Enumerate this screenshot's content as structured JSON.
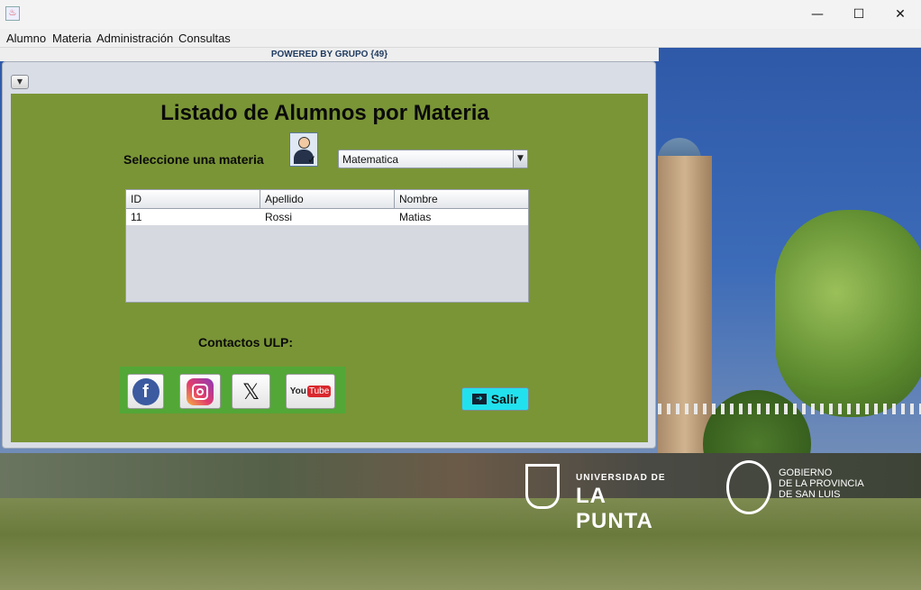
{
  "window": {
    "minimize_glyph": "—",
    "maximize_glyph": "☐",
    "close_glyph": "✕"
  },
  "menu": {
    "items": [
      "Alumno",
      "Materia",
      "Administración",
      "Consultas"
    ]
  },
  "banner": {
    "powered_text": "POWERED BY GRUPO {49}"
  },
  "form": {
    "title": "Listado de Alumnos por Materia",
    "select_label": "Seleccione una materia",
    "selected_materia": "Matematica",
    "table": {
      "columns": [
        "ID",
        "Apellido",
        "Nombre"
      ],
      "rows": [
        [
          "11",
          "Rossi",
          "Matias"
        ]
      ]
    },
    "contacts_label": "Contactos ULP:",
    "social": {
      "facebook_glyph": "f",
      "x_glyph": "𝕏",
      "youtube_text": "You",
      "youtube_badge": "Tube"
    },
    "exit_label": "Salir"
  },
  "background": {
    "ulp_top": "UNIVERSIDAD DE",
    "ulp_big": "LA PUNTA",
    "gob_text": "GOBIERNO\nDE LA PROVINCIA\nDE SAN LUIS"
  },
  "colors": {
    "panel": "#7a9536",
    "social_box": "#52a737",
    "exit_button": "#22e1ee"
  },
  "icons": {
    "app": "java-app-icon",
    "collapse": "chevron-down-icon",
    "user": "user-check-icon",
    "combo_arrow": "caret-down-icon",
    "exit": "exit-icon"
  }
}
